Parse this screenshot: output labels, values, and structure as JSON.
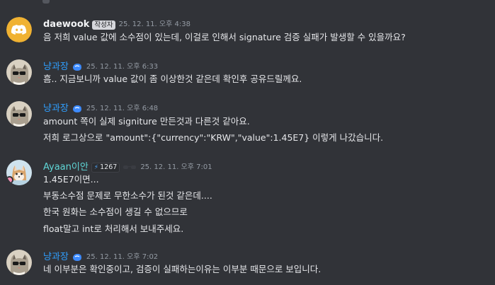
{
  "messages": [
    {
      "author": "daewook",
      "badge": "작성자",
      "timestamp": "25. 12. 11. 오후 4:38",
      "lines": [
        "음 저희 value 값에 소수점이 있는데, 이걸로 인해서 signature 검증 실패가 발생할 수 있을까요?"
      ]
    },
    {
      "author": "냥과장",
      "timestamp": "25. 12. 11. 오후 6:33",
      "lines": [
        "흠.. 지금보니까 value 값이 좀 이상한것 같은데 확인후 공유드릴께요."
      ]
    },
    {
      "author": "냥과장",
      "timestamp": "25. 12. 11. 오후 6:48",
      "lines": [
        "amount 쪽이 실제 signiture 만든것과 다른것 같아요.",
        "저희 로그상으로 \"amount\":{\"currency\":\"KRW\",\"value\":1.45E7} 이렇게 나갔습니다."
      ]
    },
    {
      "author": "Ayaan이안",
      "boost_count": "1267",
      "timestamp": "25. 12. 11. 오후 7:01",
      "lines": [
        "1.45E7이면...",
        "부동소수점 문제로 무한소수가 된것 같은데....",
        "한국 원화는 소수점이 생길 수 없으므로",
        "float말고 int로 처리해서 보내주세요."
      ]
    },
    {
      "author": "냥과장",
      "timestamp": "25. 12. 11. 오후 7:02",
      "lines": [
        "네 이부분은 확인중이고, 검증이 실패하는이유는 이부분 때문으로 보입니다."
      ]
    }
  ],
  "colors": {
    "background": "#313338",
    "discord_blurple": "#5865F2",
    "username_nyang": "#2f9fff",
    "username_ayaan": "#5fd6d6",
    "timestamp": "#949ba4"
  }
}
